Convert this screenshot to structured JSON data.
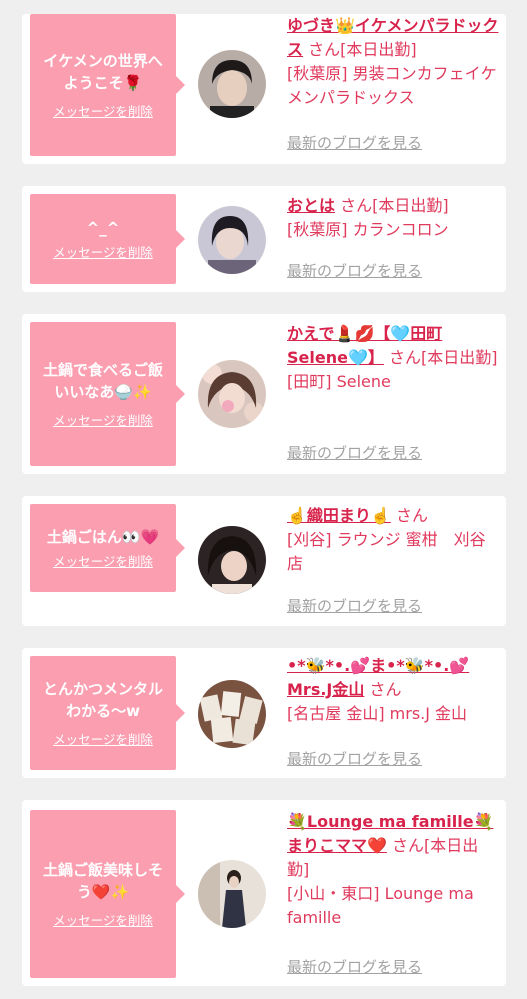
{
  "cards": [
    {
      "message": "イケメンの世界へようこそ🌹",
      "delete_label": "メッセージを削除",
      "name": "ゆづき👑イケメンパラドックス",
      "san_status": "さん[本日出勤]",
      "shop": "[秋葉原] 男装コンカフェイケメンパラドックス",
      "blog_label": "最新のブログを見る"
    },
    {
      "message": "^_^",
      "delete_label": "メッセージを削除",
      "name": "おとは",
      "san_status": "さん[本日出勤]",
      "shop": "[秋葉原] カランコロン",
      "blog_label": "最新のブログを見る"
    },
    {
      "message": "土鍋で食べるご飯いいなあ🍚✨",
      "delete_label": "メッセージを削除",
      "name": "かえで💄💋【🩵田町Selene🩵】",
      "san_status": "さん[本日出勤]",
      "shop": "[田町] Selene",
      "blog_label": "最新のブログを見る"
    },
    {
      "message": "土鍋ごはん👀💗",
      "delete_label": "メッセージを削除",
      "name": "☝️織田まり☝️",
      "san_status": "さん",
      "shop": "[刈谷] ラウンジ 蜜柑　刈谷店",
      "blog_label": "最新のブログを見る"
    },
    {
      "message": "とんかつメンタルわかる〜w",
      "delete_label": "メッセージを削除",
      "name": "•*🐝*•.💕ま•*🐝*•.💕Mrs.J金山",
      "san_status": "さん",
      "shop": "[名古屋 金山] mrs.J 金山",
      "blog_label": "最新のブログを見る"
    },
    {
      "message": "土鍋ご飯美味しそう❤️✨",
      "delete_label": "メッセージを削除",
      "name": "💐Lounge ma famille💐まりこママ❤️",
      "san_status": "さん[本日出勤]",
      "shop": "[小山・東口] Lounge ma famille",
      "blog_label": "最新のブログを見る"
    }
  ]
}
